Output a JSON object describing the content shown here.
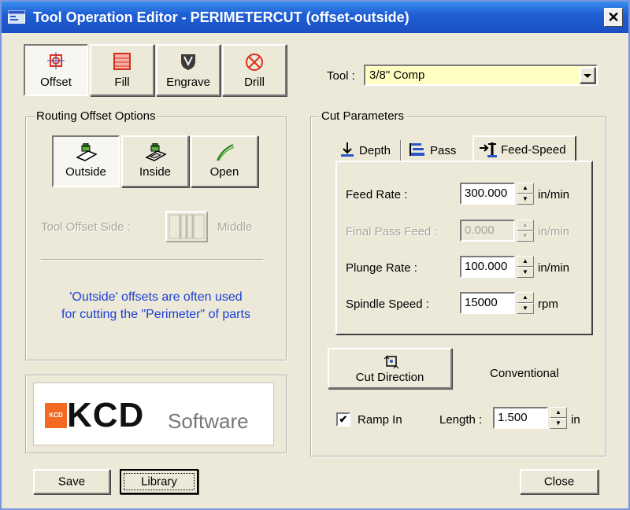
{
  "window": {
    "title": "Tool Operation Editor - PERIMETERCUT (offset-outside)",
    "close_glyph": "✕"
  },
  "mode_buttons": [
    {
      "label": "Offset",
      "icon": "offset-target-icon"
    },
    {
      "label": "Fill",
      "icon": "fill-grid-icon"
    },
    {
      "label": "Engrave",
      "icon": "engrave-shield-icon"
    },
    {
      "label": "Drill",
      "icon": "drill-crosshair-icon"
    }
  ],
  "routing": {
    "group_label": "Routing Offset Options",
    "buttons": [
      {
        "label": "Outside",
        "icon": "outside-offset-icon"
      },
      {
        "label": "Inside",
        "icon": "inside-offset-icon"
      },
      {
        "label": "Open",
        "icon": "open-path-icon"
      }
    ],
    "offset_side_label": "Tool Offset Side :",
    "offset_side_value": "Middle",
    "note_line1": "'Outside' offsets are often used",
    "note_line2": "for cutting the \"Perimeter\" of parts"
  },
  "logo": {
    "badge_text": "KCD",
    "main_text": "KCD",
    "sub_text": "Software"
  },
  "tool": {
    "label": "Tool :",
    "value": "3/8\" Comp"
  },
  "cut_params": {
    "group_label": "Cut Parameters",
    "tabs": [
      {
        "label": "Depth",
        "icon": "depth-arrow-icon"
      },
      {
        "label": "Pass",
        "icon": "pass-icon"
      },
      {
        "label": "Feed-Speed",
        "icon": "feed-speed-icon"
      }
    ],
    "fields": [
      {
        "label": "Feed Rate :",
        "value": "300.000",
        "unit": "in/min"
      },
      {
        "label": "Final Pass Feed :",
        "value": "0.000",
        "unit": "in/min"
      },
      {
        "label": "Plunge Rate :",
        "value": "100.000",
        "unit": "in/min"
      },
      {
        "label": "Spindle Speed :",
        "value": "15000",
        "unit": "rpm"
      }
    ]
  },
  "cut_direction": {
    "button_label": "Cut Direction",
    "value": "Conventional"
  },
  "ramp": {
    "checkbox_label": "Ramp In",
    "checked_glyph": "✔",
    "length_label": "Length :",
    "length_value": "1.500",
    "unit": "in"
  },
  "footer": {
    "save": "Save",
    "library": "Library",
    "close": "Close"
  },
  "colors": {
    "accent_blue": "#1c40d8",
    "tool_field_bg": "#ffffc4",
    "titlebar": "#1f5fd6",
    "kcd_orange": "#f26a21"
  }
}
